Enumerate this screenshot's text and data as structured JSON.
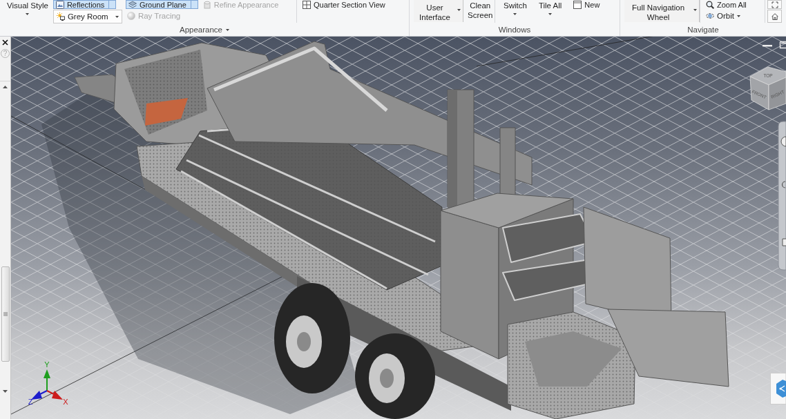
{
  "ribbon": {
    "groups": [
      {
        "label": "Appearance",
        "expandable": true,
        "sections": [
          {
            "columns": [
              [
                {
                  "kind": "large",
                  "lines": [
                    "Visual Style"
                  ],
                  "caret": true
                }
              ],
              [
                {
                  "kind": "toggle",
                  "label": "Reflections",
                  "selected": true
                },
                {
                  "kind": "dropdown",
                  "label": "Grey Room"
                }
              ],
              [
                {
                  "kind": "toggle",
                  "label": "Ground Plane",
                  "selected": true
                },
                {
                  "kind": "small",
                  "label": "Ray Tracing",
                  "disabled": true,
                  "caret": false
                }
              ],
              [
                {
                  "kind": "small",
                  "label": "Refine Appearance",
                  "disabled": true,
                  "caret": false
                }
              ]
            ]
          },
          {
            "columns": [
              [
                {
                  "kind": "small",
                  "label": "Quarter Section View",
                  "disabled": false,
                  "caret": false
                }
              ]
            ]
          }
        ]
      },
      {
        "label": "Windows",
        "expandable": false,
        "sections": [
          {
            "columns": [
              [
                {
                  "kind": "large",
                  "lines": [
                    "User",
                    "Interface"
                  ],
                  "caret": true
                }
              ],
              [
                {
                  "kind": "large",
                  "lines": [
                    "Clean",
                    "Screen"
                  ],
                  "caret": false
                }
              ]
            ]
          },
          {
            "columns": [
              [
                {
                  "kind": "large",
                  "lines": [
                    "Switch"
                  ],
                  "caret": true
                }
              ],
              [
                {
                  "kind": "large",
                  "lines": [
                    "Tile All"
                  ],
                  "caret": true
                }
              ],
              [
                {
                  "kind": "small",
                  "label": "New",
                  "disabled": false,
                  "caret": false
                }
              ]
            ]
          }
        ]
      },
      {
        "label": "Navigate",
        "expandable": false,
        "sections": [
          {
            "columns": [
              [
                {
                  "kind": "large",
                  "lines": [
                    "Full Navigation",
                    "Wheel"
                  ],
                  "caret": true
                }
              ]
            ]
          },
          {
            "columns": [
              [
                {
                  "kind": "small",
                  "label": "Zoom All",
                  "disabled": false,
                  "caret": false
                },
                {
                  "kind": "small",
                  "label": "Orbit",
                  "disabled": false,
                  "caret": true
                }
              ]
            ]
          },
          {
            "columns": [
              [
                {
                  "kind": "icon"
                },
                {
                  "kind": "icon"
                }
              ]
            ]
          }
        ]
      }
    ]
  },
  "side_panel": {
    "help": "?"
  },
  "viewport": {
    "view_cube": {
      "faces": [
        {
          "label": "TOP"
        },
        {
          "label": "FRONT"
        },
        {
          "label": "RIGHT"
        }
      ]
    },
    "axes": [
      {
        "label": "Y",
        "color": "#1e9e1e"
      },
      {
        "label": "Z",
        "color": "#1c1ccc"
      },
      {
        "label": "X",
        "color": "#cc1c1c"
      }
    ]
  }
}
